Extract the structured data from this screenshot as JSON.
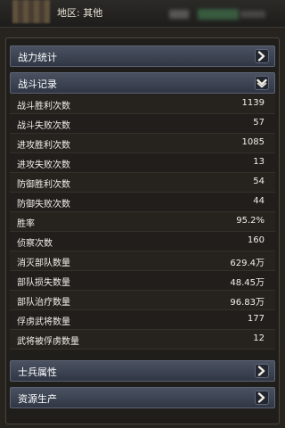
{
  "header": {
    "region": "地区: 其他"
  },
  "sections": {
    "combat_power": {
      "label": "战力统计",
      "icon": "chevron-right-icon"
    },
    "battle_record": {
      "label": "战斗记录",
      "icon": "chevron-down-icon"
    },
    "soldier_attr": {
      "label": "士兵属性",
      "icon": "chevron-right-icon"
    },
    "resource_prod": {
      "label": "资源生产",
      "icon": "chevron-right-icon"
    }
  },
  "stats": [
    {
      "label": "战斗胜利次数",
      "value": "1139"
    },
    {
      "label": "战斗失败次数",
      "value": "57"
    },
    {
      "label": "进攻胜利次数",
      "value": "1085"
    },
    {
      "label": "进攻失败次数",
      "value": "13"
    },
    {
      "label": "防御胜利次数",
      "value": "54"
    },
    {
      "label": "防御失败次数",
      "value": "44"
    },
    {
      "label": "胜率",
      "value": "95.2%"
    },
    {
      "label": "侦察次数",
      "value": "160"
    },
    {
      "label": "消灭部队数量",
      "value": "629.4万"
    },
    {
      "label": "部队损失数量",
      "value": "48.45万"
    },
    {
      "label": "部队治疗数量",
      "value": "96.83万"
    },
    {
      "label": "俘虏武将数量",
      "value": "177"
    },
    {
      "label": "武将被俘虏数量",
      "value": "12"
    }
  ],
  "colors": {
    "header_gradient_top": "#4a5262",
    "header_gradient_bottom": "#303644",
    "chevron": "#f2ede2"
  }
}
